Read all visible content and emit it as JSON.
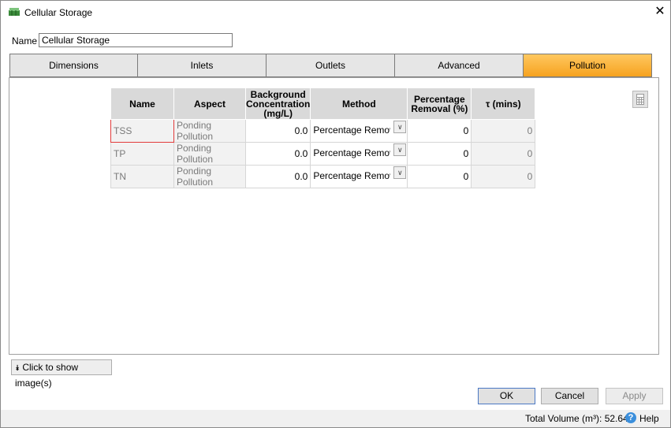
{
  "window": {
    "title": "Cellular Storage",
    "icon": "cellular-storage-icon",
    "close": "✕"
  },
  "name_field": {
    "label": "Name",
    "value": "Cellular Storage"
  },
  "tabs": [
    {
      "label": "Dimensions"
    },
    {
      "label": "Inlets"
    },
    {
      "label": "Outlets"
    },
    {
      "label": "Advanced"
    },
    {
      "label": "Pollution",
      "active": true
    }
  ],
  "table": {
    "headers": [
      "Name",
      "Aspect",
      "Background Concentration (mg/L)",
      "Method",
      "Percentage Removal (%)",
      "τ (mins)"
    ],
    "rows": [
      {
        "name": "TSS",
        "aspect": "Ponding Pollution",
        "bg": "0.0",
        "method": "Percentage Removal",
        "pct": "0",
        "tau": "0"
      },
      {
        "name": "TP",
        "aspect": "Ponding Pollution",
        "bg": "0.0",
        "method": "Percentage Removal",
        "pct": "0",
        "tau": "0"
      },
      {
        "name": "TN",
        "aspect": "Ponding Pollution",
        "bg": "0.0",
        "method": "Percentage Removal",
        "pct": "0",
        "tau": "0"
      }
    ]
  },
  "show_images": {
    "label": "Click to show image(s)"
  },
  "buttons": {
    "ok": "OK",
    "cancel": "Cancel",
    "apply": "Apply"
  },
  "status": {
    "total_volume": "Total Volume (m³): 52.640",
    "help": "Help"
  },
  "colors": {
    "active_tab": "#f6a21f",
    "selected_cell_border": "#e23b3b",
    "help_icon": "#3b8fdc"
  }
}
